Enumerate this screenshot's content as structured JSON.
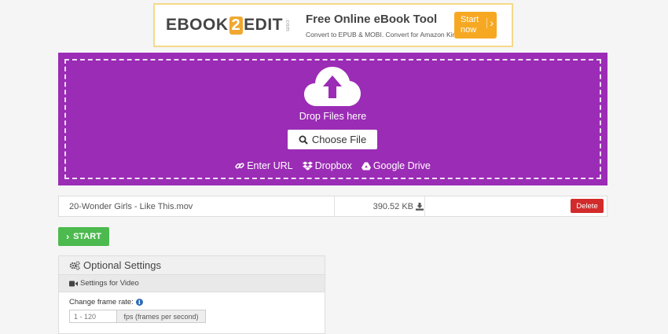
{
  "ad": {
    "logo_left": "EBOOK",
    "logo_mid": "2",
    "logo_right": "EDIT",
    "logo_com": ".com",
    "title": "Free Online eBook Tool",
    "subtitle": "Convert to EPUB & MOBI. Convert for Amazon Kindle",
    "button_line1": "Start",
    "button_line2": "now"
  },
  "upload": {
    "drop_text": "Drop Files here",
    "choose_label": "Choose File",
    "sources": [
      {
        "icon": "link-icon",
        "label": "Enter URL"
      },
      {
        "icon": "dropbox-icon",
        "label": "Dropbox"
      },
      {
        "icon": "google-drive-icon",
        "label": "Google Drive"
      }
    ]
  },
  "file": {
    "name": "20-Wonder Girls - Like This.mov",
    "size": "390.52 KB",
    "delete_label": "Delete"
  },
  "start_label": "START",
  "optional": {
    "title": "Optional Settings",
    "section": "Settings for Video",
    "frame_rate_label": "Change frame rate:",
    "frame_rate_placeholder": "1 - 120",
    "frame_rate_unit": "fps (frames per second)"
  },
  "colors": {
    "drop_bg": "#9b2cb5",
    "start_bg": "#4cba4f",
    "delete_bg": "#d22b2b",
    "ad_button": "#f7a823"
  }
}
